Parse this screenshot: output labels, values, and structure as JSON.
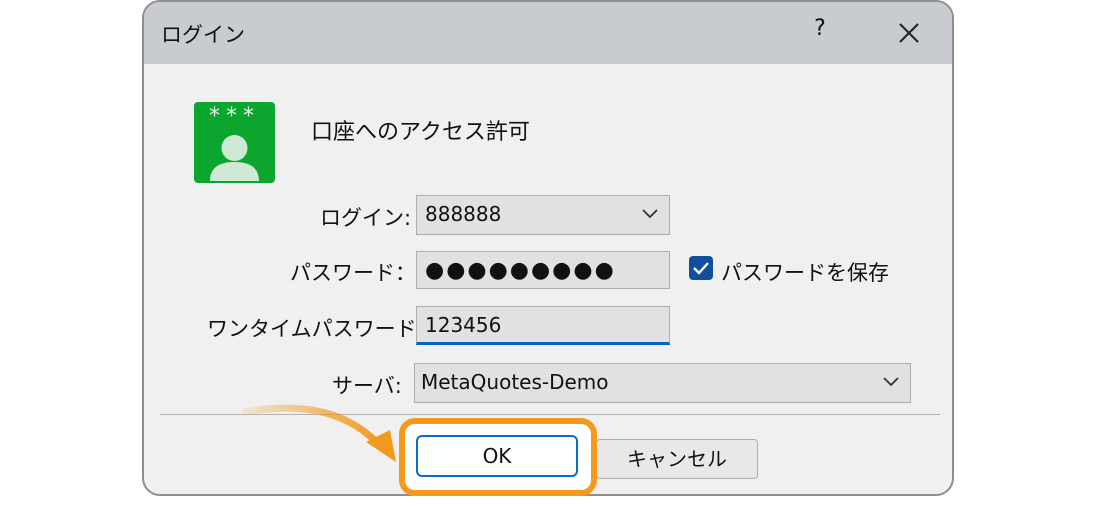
{
  "dialog": {
    "title": "ログイン",
    "help_label": "?",
    "heading": "口座へのアクセス許可",
    "icon_stars": "***"
  },
  "form": {
    "login_label": "ログイン:",
    "login_value": "888888",
    "password_label": "パスワード：",
    "password_value": "●●●●●●●●●",
    "save_password_label": "パスワードを保存",
    "save_password_checked": true,
    "otp_label": "ワンタイムパスワード:",
    "otp_value": "123456",
    "server_label": "サーバ:",
    "server_value": "MetaQuotes-Demo"
  },
  "buttons": {
    "ok_label": "OK",
    "cancel_label": "キャンセル"
  },
  "colors": {
    "accent": "#0067c0",
    "highlight": "#f39a1e",
    "icon_green": "#0ca62e"
  }
}
